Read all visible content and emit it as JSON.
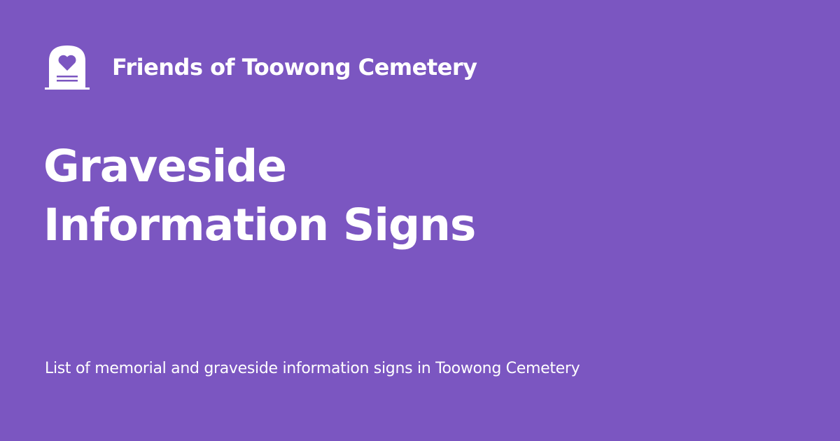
{
  "header": {
    "logo_icon": "headstone-heart-icon",
    "site_name": "Friends of Toowong Cemetery"
  },
  "main": {
    "title_line_1": "Graveside",
    "title_line_2": "Information Signs",
    "description": "List of memorial and graveside information signs in Toowong Cemetery"
  },
  "colors": {
    "background": "#7b56c1",
    "text": "#ffffff"
  }
}
